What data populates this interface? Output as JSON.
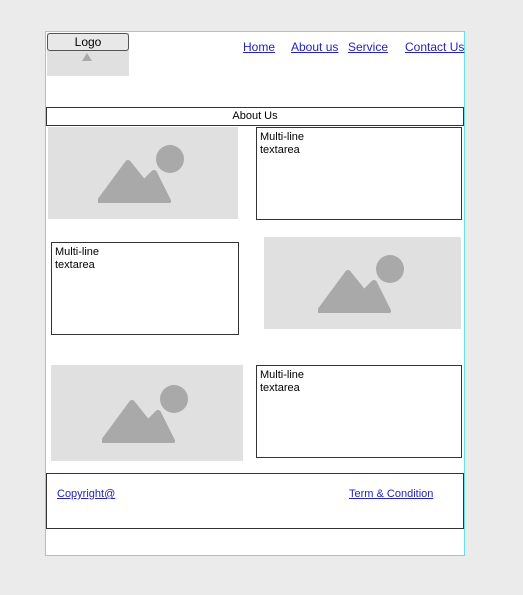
{
  "header": {
    "logo_label": "Logo",
    "nav": [
      "Home",
      "About us",
      "Service",
      "Contact Us"
    ]
  },
  "about_bar": {
    "title": "About Us"
  },
  "sections": [
    {
      "textarea": "Multi-line\ntextarea"
    },
    {
      "textarea": "Multi-line\ntextarea"
    },
    {
      "textarea": "Multi-line\ntextarea"
    }
  ],
  "footer": {
    "copyright": "Copyright@",
    "terms": "Term & Condition"
  },
  "colors": {
    "frame_border": "#5fe3e6",
    "link": "#2222cc",
    "placeholder_bg": "#e0e0e0",
    "placeholder_icon": "#a9a9a9"
  }
}
